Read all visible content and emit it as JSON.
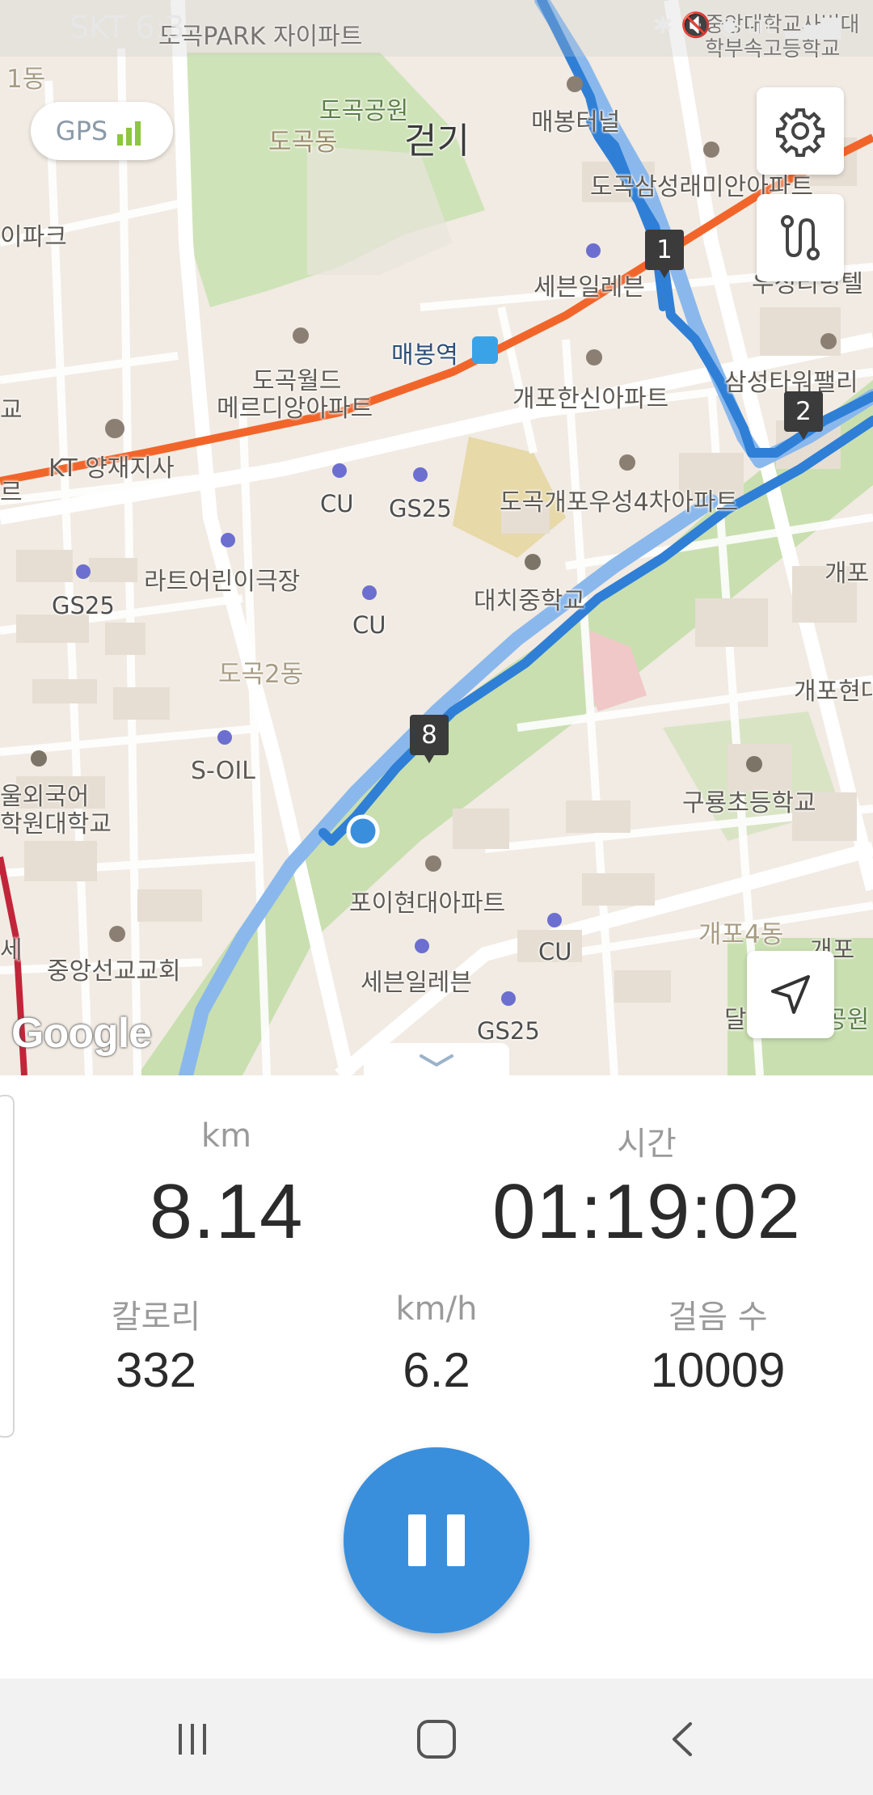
{
  "status_bar": {
    "carrier": "SKT 6:3",
    "icons": [
      "bluetooth-icon",
      "mute-icon",
      "location-icon",
      "lte-icon",
      "signal-icon"
    ]
  },
  "map": {
    "gps_label": "GPS",
    "activity_label": "걷기",
    "attribution": "Google",
    "settings_icon": "gear-icon",
    "route_icon": "route-icon",
    "locate_icon": "navigation-arrow-icon",
    "collapse_icon": "chevron-down-icon",
    "labels": [
      {
        "text": "도곡PARK 자이파트",
        "type": "place"
      },
      {
        "text": "중앙대학교사범대학부속고등학교",
        "type": "place"
      },
      {
        "text": "1동",
        "type": "dist"
      },
      {
        "text": "도곡공원",
        "type": "park"
      },
      {
        "text": "도곡동",
        "type": "dist"
      },
      {
        "text": "매봉터널",
        "type": "place"
      },
      {
        "text": "도곡삼성래미안아파트",
        "type": "place"
      },
      {
        "text": "이파크",
        "type": "place"
      },
      {
        "text": "세븐일레븐",
        "type": "place"
      },
      {
        "text": "우성리빙텔",
        "type": "place"
      },
      {
        "text": "매봉역",
        "type": "place"
      },
      {
        "text": "도곡월드",
        "type": "place"
      },
      {
        "text": "메르디앙아파트",
        "type": "place"
      },
      {
        "text": "개포한신아파트",
        "type": "place"
      },
      {
        "text": "삼성타워팰리",
        "type": "place"
      },
      {
        "text": "KT 양재지사",
        "type": "place"
      },
      {
        "text": "CU",
        "type": "store"
      },
      {
        "text": "GS25",
        "type": "store"
      },
      {
        "text": "도곡개포우성4차아파트",
        "type": "place"
      },
      {
        "text": "라트어린이극장",
        "type": "place"
      },
      {
        "text": "GS25",
        "type": "store"
      },
      {
        "text": "대치중학교",
        "type": "place"
      },
      {
        "text": "개포",
        "type": "place"
      },
      {
        "text": "CU",
        "type": "store"
      },
      {
        "text": "도곡2동",
        "type": "dist"
      },
      {
        "text": "개포현대",
        "type": "place"
      },
      {
        "text": "S-OIL",
        "type": "place"
      },
      {
        "text": "구룡초등학교",
        "type": "place"
      },
      {
        "text": "울외국어",
        "type": "place"
      },
      {
        "text": "학원대학교",
        "type": "place"
      },
      {
        "text": "포이현대아파트",
        "type": "place"
      },
      {
        "text": "개포4동",
        "type": "dist"
      },
      {
        "text": "개포",
        "type": "place"
      },
      {
        "text": "CU",
        "type": "store"
      },
      {
        "text": "중앙선교교회",
        "type": "place"
      },
      {
        "text": "세븐일레븐",
        "type": "place"
      },
      {
        "text": "GS25",
        "type": "store"
      },
      {
        "text": "달",
        "type": "place"
      },
      {
        "text": "공원",
        "type": "park"
      },
      {
        "text": "세",
        "type": "place"
      },
      {
        "text": "교",
        "type": "place"
      },
      {
        "text": "르",
        "type": "place"
      }
    ],
    "km_markers": [
      "1",
      "2",
      "8"
    ]
  },
  "stats": {
    "distance_label": "km",
    "distance_value": "8.14",
    "time_label": "시간",
    "time_value": "01:19:02",
    "calories_label": "칼로리",
    "calories_value": "332",
    "speed_label": "km/h",
    "speed_value": "6.2",
    "steps_label": "걸음 수",
    "steps_value": "10009"
  },
  "controls": {
    "pause_icon": "pause-icon"
  },
  "navbar": {
    "recents_icon": "recents-icon",
    "home_icon": "home-icon",
    "back_icon": "back-icon"
  },
  "colors": {
    "route": "#2f7fd6",
    "accent": "#3a8fdc",
    "subway_line": "#f2652a",
    "park": "#c9dfb0"
  }
}
